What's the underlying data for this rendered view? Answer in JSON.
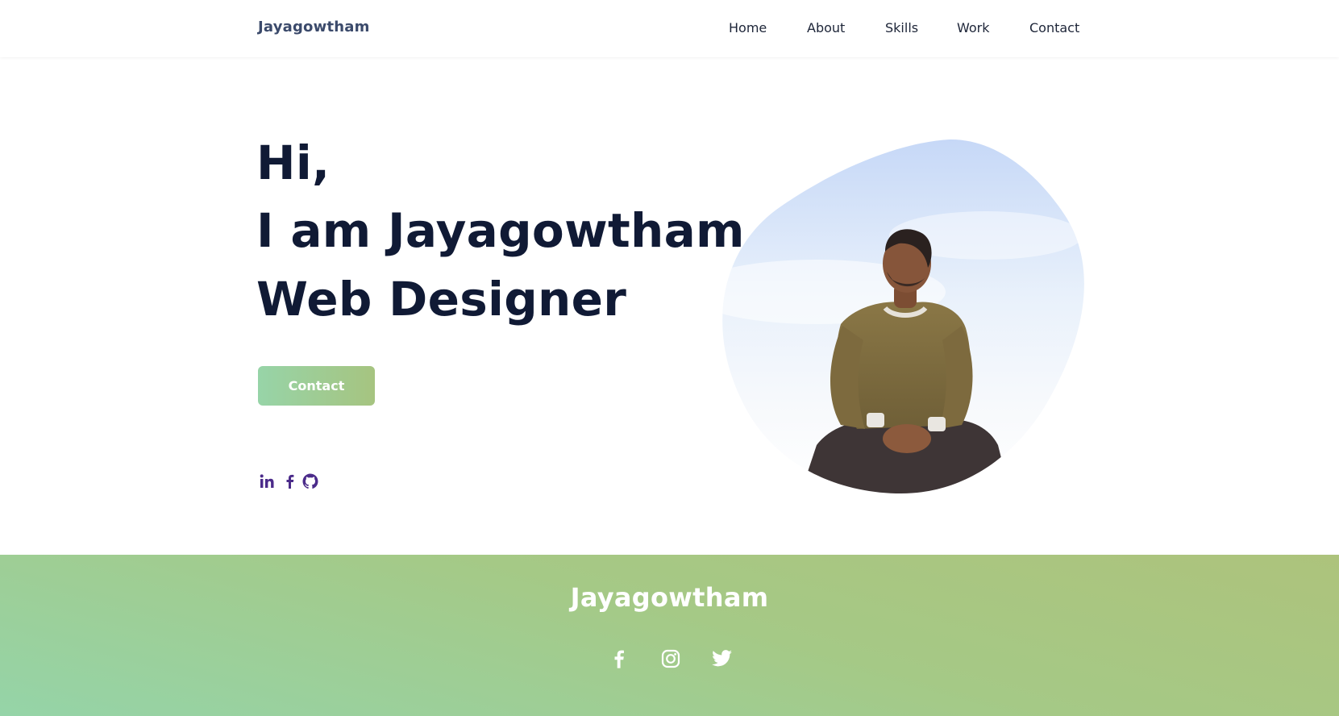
{
  "header": {
    "logo": "Jayagowtham",
    "nav": [
      "Home",
      "About",
      "Skills",
      "Work",
      "Contact"
    ]
  },
  "hero": {
    "line1": "Hi,",
    "line2": "I am Jayagowtham",
    "line3": "Web Designer",
    "button_label": "Contact",
    "social_icons": [
      "linkedin-icon",
      "facebook-icon",
      "github-icon"
    ],
    "image_alt": "photo of a man sitting outdoors against a pale blue sky"
  },
  "footer": {
    "title": "Jayagowtham",
    "social_icons": [
      "facebook-icon",
      "instagram-icon",
      "twitter-icon"
    ]
  },
  "colors": {
    "text_dark": "#101a35",
    "logo": "#3b4a6b",
    "gradient_start": "#97d4a8",
    "gradient_end": "#a6c480",
    "social_icon": "#4b2b8a"
  }
}
